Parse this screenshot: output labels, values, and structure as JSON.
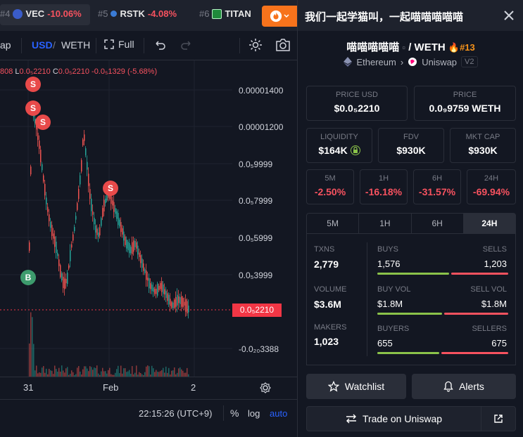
{
  "ticker": [
    {
      "rank": "#4",
      "symbol": "VEC",
      "change": "-10.06%",
      "icon": "vec-coin-icon"
    },
    {
      "rank": "#5",
      "symbol": "RSTK",
      "change": "-4.08%",
      "icon": "rstk-coin-icon"
    },
    {
      "rank": "#6",
      "symbol": "TITAN",
      "change": "",
      "icon": "titan-coin-icon"
    }
  ],
  "chart_toolbar": {
    "swap_partial": "ap",
    "currency": "USD",
    "slash": "/",
    "pair_quote": "WETH",
    "full_label": "Full"
  },
  "ohlc": {
    "partial": "808",
    "l_label": "L",
    "l_value": "0.0₅2210",
    "c_label": "C",
    "c_value": "0.0₅2210",
    "change": "-0.0₅1329 (-5.68%)"
  },
  "chart_data": {
    "type": "candlestick",
    "y_labels": [
      "0.00001400",
      "0.00001200",
      "0.0₅9999",
      "0.0₅7999",
      "0.0₅5999",
      "0.0₅3999",
      "-0.0₂₀3388"
    ],
    "current_price": "0.0₅2210",
    "x_labels": [
      "31",
      "Feb",
      "2"
    ],
    "markers": [
      {
        "type": "S"
      },
      {
        "type": "S"
      },
      {
        "type": "S"
      },
      {
        "type": "S"
      },
      {
        "type": "B"
      }
    ]
  },
  "bottom_bar": {
    "clock": "22:15:26 (UTC+9)",
    "pct": "%",
    "log": "log",
    "auto": "auto"
  },
  "panel": {
    "title": "我们一起学猫叫，一起喵喵喵喵喵",
    "pair_base": "喵喵喵喵喵",
    "pair_sep": "/",
    "pair_quote": "WETH",
    "rank": "#13",
    "chain": "Ethereum",
    "dex": "Uniswap",
    "version": "V2",
    "price_usd_label": "PRICE USD",
    "price_usd": "$0.0₅2210",
    "price_label": "PRICE",
    "price_weth": "0.0₉9759 WETH",
    "liquidity_label": "LIQUIDITY",
    "liquidity": "$164K",
    "fdv_label": "FDV",
    "fdv": "$930K",
    "mktcap_label": "MKT CAP",
    "mktcap": "$930K",
    "changes": [
      {
        "period": "5M",
        "value": "-2.50%"
      },
      {
        "period": "1H",
        "value": "-16.18%"
      },
      {
        "period": "6H",
        "value": "-31.57%"
      },
      {
        "period": "24H",
        "value": "-69.94%"
      }
    ],
    "tabs": [
      "5M",
      "1H",
      "6H",
      "24H"
    ],
    "active_tab": "24H",
    "stats": {
      "txns_label": "TXNS",
      "txns": "2,779",
      "volume_label": "VOLUME",
      "volume": "$3.6M",
      "makers_label": "MAKERS",
      "makers": "1,023",
      "buys_label": "BUYS",
      "buys": "1,576",
      "sells_label": "SELLS",
      "sells": "1,203",
      "buy_vol_label": "BUY VOL",
      "buy_vol": "$1.8M",
      "sell_vol_label": "SELL VOL",
      "sell_vol": "$1.8M",
      "buyers_label": "BUYERS",
      "buyers": "655",
      "sellers_label": "SELLERS",
      "sellers": "675"
    },
    "watchlist_label": "Watchlist",
    "alerts_label": "Alerts",
    "trade_label": "Trade on Uniswap"
  },
  "colors": {
    "accent_blue": "#2962ff",
    "negative": "#f7525f",
    "positive": "#26a69a",
    "buy_bar": "#8bc34a",
    "orange": "#f7731c"
  }
}
